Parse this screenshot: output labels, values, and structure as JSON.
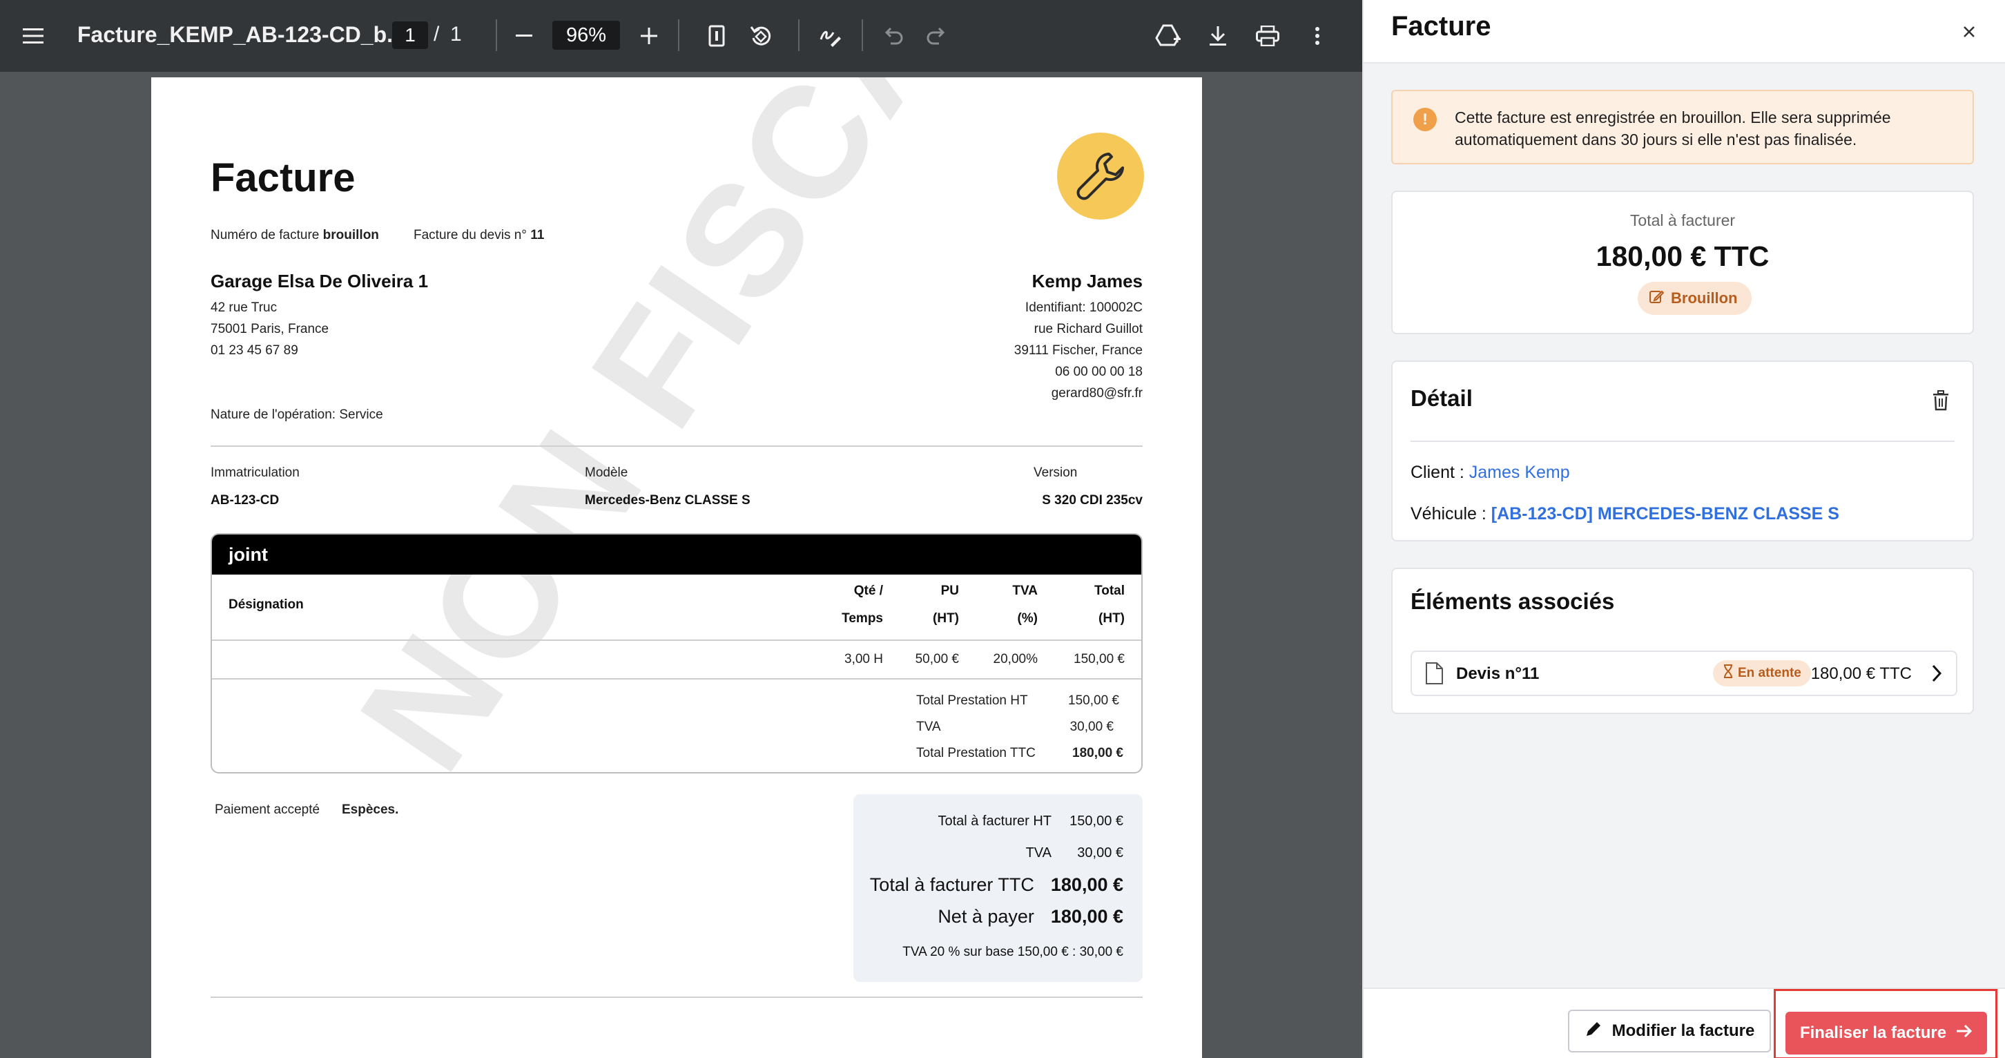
{
  "viewer": {
    "doc_title": "Facture_KEMP_AB-123-CD_b...",
    "current_page": "1",
    "page_separator": "/",
    "total_pages": "1",
    "zoom": "96%"
  },
  "invoice": {
    "title": "Facture",
    "number_label": "Numéro de facture",
    "number_value": "brouillon",
    "quote_label": "Facture du devis n°",
    "quote_value": "11",
    "garage": {
      "name": "Garage Elsa De Oliveira 1",
      "lines": [
        "42 rue Truc",
        "75001 Paris, France",
        "01 23 45 67 89"
      ]
    },
    "client": {
      "name": "Kemp James",
      "lines": [
        "Identifiant: 100002C",
        "rue Richard Guillot",
        "39111 Fischer, France",
        "06 00 00 00 18",
        "gerard80@sfr.fr"
      ]
    },
    "nature": "Nature de l'opération: Service",
    "vehicle": {
      "plate_label": "Immatriculation",
      "plate_value": "AB-123-CD",
      "model_label": "Modèle",
      "model_value": "Mercedes-Benz CLASSE S",
      "version_label": "Version",
      "version_value": "S 320 CDI 235cv"
    },
    "section_title": "joint",
    "columns": {
      "designation": "Désignation",
      "qty_1": "Qté /",
      "qty_2": "Temps",
      "pu_1": "PU",
      "pu_2": "(HT)",
      "tva_1": "TVA",
      "tva_2": "(%)",
      "total_1": "Total",
      "total_2": "(HT)"
    },
    "line": {
      "qty": "3,00 H",
      "pu": "50,00 €",
      "tva": "20,00%",
      "total": "150,00 €"
    },
    "subtotals": [
      {
        "label": "Total Prestation HT",
        "value": "150,00 €"
      },
      {
        "label": "TVA",
        "value": "30,00 €"
      },
      {
        "label": "Total Prestation TTC",
        "value": "180,00 €"
      }
    ],
    "payment_label": "Paiement accepté",
    "payment_value": "Espèces.",
    "totals": {
      "ht_label": "Total à facturer HT",
      "ht_value": "150,00 €",
      "tva_label": "TVA",
      "tva_value": "30,00 €",
      "ttc_label": "Total à facturer TTC",
      "ttc_value": "180,00 €",
      "net_label": "Net à payer",
      "net_value": "180,00 €",
      "tva_note": "TVA 20 % sur base 150,00 € : 30,00 €"
    },
    "watermark": "NON FISCAL"
  },
  "panel": {
    "title": "Facture",
    "alert": "Cette facture est enregistrée en brouillon. Elle sera supprimée automatiquement dans 30 jours si elle n'est pas finalisée.",
    "alert_icon_glyph": "!",
    "total_label": "Total à facturer",
    "total_amount": "180,00 € TTC",
    "status": "Brouillon",
    "detail_title": "Détail",
    "client_label": "Client :",
    "client_value": "James Kemp",
    "vehicle_label": "Véhicule :",
    "vehicle_value": "[AB-123-CD] MERCEDES-BENZ CLASSE S",
    "assoc_title": "Éléments associés",
    "assoc_item": {
      "name": "Devis n°11",
      "status": "En attente",
      "amount": "180,00 € TTC"
    },
    "edit_button": "Modifier la facture",
    "finalize_button": "Finaliser la facture"
  },
  "colors": {
    "toolbar_bg": "#323639",
    "viewer_bg": "#525659",
    "logo_bg": "#f6c858",
    "alert_bg": "#fdf0e3",
    "status_bg": "#fbe6d5",
    "status_fg": "#b85c1c",
    "link": "#2f6fde",
    "primary_button": "#e8545a",
    "highlight_border": "#e53935"
  }
}
